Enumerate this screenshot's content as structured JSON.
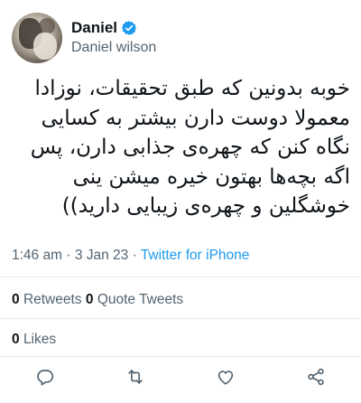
{
  "author": {
    "display_name": "Daniel",
    "handle": "Daniel wilson",
    "verified_icon": "verified-badge-icon",
    "verified_color": "#1d9bf0"
  },
  "tweet": {
    "text_lines": [
      "خوبه بدونین که طبق تحقیقات، نوزادا",
      "معمولا دوست دارن بیشتر به کسایی",
      "نگاه کنن که چهره‌ی جذابی دارن، پس",
      "اگه بچه‌ها بهتون خیره میشن ینی",
      "خوشگلین و چهره‌ی زیبایی دارید))"
    ],
    "time": "1:46 am",
    "separator": "·",
    "date": "3 Jan 23",
    "source": "Twitter for iPhone"
  },
  "stats": {
    "retweets_count": "0",
    "retweets_label": "Retweets",
    "quotes_count": "0",
    "quotes_label": "Quote Tweets",
    "likes_count": "0",
    "likes_label": "Likes"
  },
  "actions": [
    "reply-icon",
    "retweet-icon",
    "like-icon",
    "share-icon"
  ],
  "colors": {
    "text": "#0f1419",
    "secondary": "#536471",
    "accent": "#1d9bf0",
    "divider": "#e6ecf0"
  }
}
